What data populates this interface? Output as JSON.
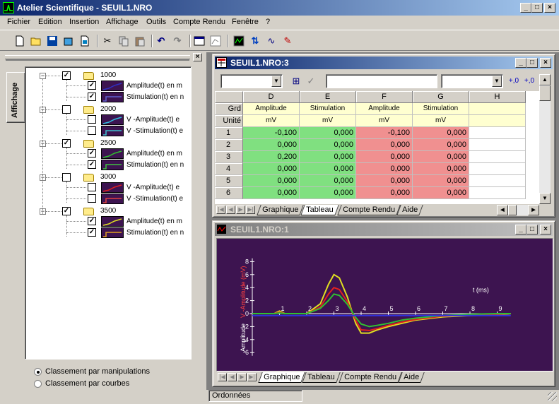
{
  "app": {
    "title": "Atelier Scientifique - SEUIL1.NRO"
  },
  "menu": [
    "Fichier",
    "Edition",
    "Insertion",
    "Affichage",
    "Outils",
    "Compte Rendu",
    "Fenêtre",
    "?"
  ],
  "toolbar": {
    "icons": [
      "new-icon",
      "open-icon",
      "save-icon",
      "package-icon",
      "export-icon",
      "cut-icon",
      "copy-icon",
      "paste-icon",
      "undo-icon",
      "redo-icon",
      "window-icon",
      "chart-icon",
      "data-icon",
      "calc-icon",
      "fit-icon",
      "tool-icon"
    ]
  },
  "sidebar": {
    "tab_label": "Affichage",
    "groups": [
      {
        "label": "1000",
        "checked": true,
        "items": [
          {
            "label": "Amplitude(t) en m",
            "checked": true,
            "color": "#3030c0"
          },
          {
            "label": "Stimulation(t) en n",
            "checked": true,
            "color": "#6060d0"
          }
        ]
      },
      {
        "label": "2000",
        "checked": false,
        "items": [
          {
            "label": "V -Amplitude(t) e",
            "checked": false,
            "color": "#30c0e0"
          },
          {
            "label": "V -Stimulation(t) e",
            "checked": false,
            "color": "#40c0d0"
          }
        ]
      },
      {
        "label": "2500",
        "checked": true,
        "items": [
          {
            "label": "Amplitude(t) en m",
            "checked": true,
            "color": "#30c030"
          },
          {
            "label": "Stimulation(t) en n",
            "checked": true,
            "color": "#40c040"
          }
        ]
      },
      {
        "label": "3000",
        "checked": false,
        "items": [
          {
            "label": "V -Amplitude(t) e",
            "checked": false,
            "color": "#e02020"
          },
          {
            "label": "V -Stimulation(t) e",
            "checked": false,
            "color": "#e04040"
          }
        ]
      },
      {
        "label": "3500",
        "checked": true,
        "items": [
          {
            "label": "Amplitude(t) en m",
            "checked": true,
            "color": "#e0e020"
          },
          {
            "label": "Stimulation(t) en n",
            "checked": true,
            "color": "#e0a020"
          }
        ]
      }
    ],
    "sort_options": [
      {
        "label": "Classement par manipulations",
        "selected": true
      },
      {
        "label": "Classement par courbes",
        "selected": false
      }
    ]
  },
  "table_window": {
    "title": "SEUIL1.NRO:3",
    "columns": [
      "D",
      "E",
      "F",
      "G",
      "H"
    ],
    "row_label_grd": "Grd",
    "row_label_unit": "Unité",
    "grandeurs": [
      "Amplitude",
      "Stimulation",
      "Amplitude",
      "Stimulation",
      ""
    ],
    "units": [
      "mV",
      "mV",
      "mV",
      "mV",
      ""
    ],
    "rows": [
      {
        "n": "1",
        "vals": [
          "-0,100",
          "0,000",
          "-0,100",
          "0,000"
        ]
      },
      {
        "n": "2",
        "vals": [
          "0,000",
          "0,000",
          "0,000",
          "0,000"
        ]
      },
      {
        "n": "3",
        "vals": [
          "0,200",
          "0,000",
          "0,000",
          "0,000"
        ]
      },
      {
        "n": "4",
        "vals": [
          "0,000",
          "0,000",
          "0,000",
          "0,000"
        ]
      },
      {
        "n": "5",
        "vals": [
          "0,000",
          "0,000",
          "0,000",
          "0,000"
        ]
      },
      {
        "n": "6",
        "vals": [
          "0,000",
          "0,000",
          "0,000",
          "0,000"
        ]
      }
    ],
    "tabs": [
      "Graphique",
      "Tableau",
      "Compte Rendu",
      "Aide"
    ],
    "active_tab": "Tableau",
    "col_colors": [
      "#80e080",
      "#80e080",
      "#f09090",
      "#f09090",
      "#ffffff"
    ]
  },
  "graph_window": {
    "title": "SEUIL1.NRO:1",
    "tabs": [
      "Graphique",
      "Tableau",
      "Compte Rendu",
      "Aide"
    ],
    "active_tab": "Graphique"
  },
  "chart_data": {
    "type": "line",
    "xlabel": "t (ms)",
    "ylabel_1": "Amplitude",
    "ylabel_2": "V -Amplitude (mV)",
    "xlim": [
      0,
      9.5
    ],
    "ylim": [
      -7,
      9
    ],
    "x_ticks": [
      "1",
      "2",
      "3",
      "4",
      "5",
      "6",
      "7",
      "8",
      "9"
    ],
    "y_ticks": [
      "8",
      "6",
      "4",
      "2",
      "0",
      "-2",
      "-4",
      "-6"
    ],
    "background": "#3d1450",
    "series": [
      {
        "color": "#e0e020",
        "x": [
          0,
          0.8,
          1.0,
          1.2,
          1.5,
          2.0,
          2.5,
          2.8,
          3.0,
          3.2,
          3.5,
          3.8,
          4.0,
          4.3,
          4.6,
          5.0,
          5.5,
          6.0,
          7.0,
          8.0,
          9.0,
          9.5
        ],
        "y": [
          0,
          0,
          0.4,
          0,
          0,
          0,
          1.5,
          4.5,
          6,
          5.5,
          2.5,
          -1.5,
          -3,
          -3,
          -2.5,
          -2,
          -1.5,
          -1,
          -0.5,
          -0.3,
          -0.2,
          0
        ]
      },
      {
        "color": "#e02020",
        "x": [
          0,
          0.8,
          1.0,
          1.2,
          1.5,
          2.0,
          2.5,
          2.8,
          3.0,
          3.2,
          3.5,
          3.8,
          4.0,
          4.3,
          4.6,
          5.0,
          5.5,
          6.0,
          7.0,
          8.0,
          9.0,
          9.5
        ],
        "y": [
          0,
          0,
          0.2,
          0,
          0,
          0,
          1,
          3,
          4,
          3.7,
          1.8,
          -1,
          -2.5,
          -2.6,
          -2.3,
          -1.8,
          -1.3,
          -0.9,
          -0.4,
          -0.2,
          -0.1,
          0
        ]
      },
      {
        "color": "#30c030",
        "x": [
          0,
          0.8,
          1.0,
          1.2,
          1.5,
          2.0,
          2.5,
          2.8,
          3.0,
          3.2,
          3.5,
          3.8,
          4.0,
          4.3,
          4.6,
          5.0,
          5.5,
          6.0,
          7.0,
          8.0,
          9.0,
          9.5
        ],
        "y": [
          0,
          0,
          0.1,
          0,
          0,
          0,
          0.8,
          2,
          3,
          2.8,
          1.4,
          -0.6,
          -1.6,
          -2,
          -1.8,
          -1.5,
          -1,
          -0.7,
          -0.3,
          -0.1,
          0,
          0
        ]
      },
      {
        "color": "#3030e0",
        "x": [
          0,
          9.5
        ],
        "y": [
          -0.3,
          -0.3
        ]
      }
    ]
  },
  "statusbar": {
    "text": "Ordonnées"
  }
}
